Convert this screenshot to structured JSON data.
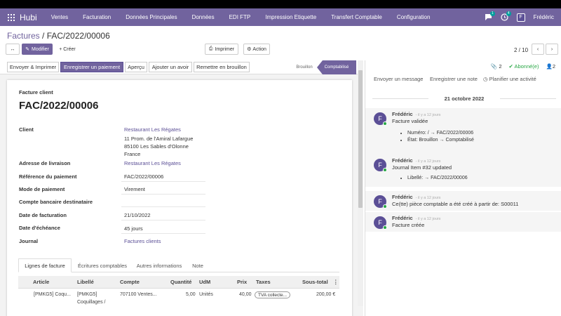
{
  "app": {
    "brand": "Hubi",
    "menu": [
      "Ventes",
      "Facturation",
      "Données Principales",
      "Données",
      "EDI FTP",
      "Impression Etiquette",
      "Transfert Comptable",
      "Configuration"
    ],
    "chat_badge": "1",
    "activity_badge": "4",
    "user_initial": "F",
    "user_name": "Frédéric"
  },
  "breadcrumb": {
    "parent": "Factures",
    "sep": " / ",
    "current": "FAC/2022/00006"
  },
  "toolbar": {
    "edit": "Modifier",
    "create": "+ Créer",
    "print": "Imprimer",
    "action": "Action",
    "pager": "2 / 10"
  },
  "statusbar": {
    "send_print": "Envoyer & Imprimer",
    "register_payment": "Enregistrer un paiement",
    "preview": "Aperçu",
    "credit_note": "Ajouter un avoir",
    "reset_draft": "Remettre en brouillon",
    "stage_draft": "Brouillon",
    "stage_posted": "Comptabilisé"
  },
  "invoice": {
    "type": "Facture client",
    "number": "FAC/2022/00006",
    "fields": {
      "client_label": "Client",
      "client_name": "Restaurant Les Régates",
      "addr1": "11 Prom. de l'Amiral Lafargue",
      "addr2": "85100 Les Sables d'Olonne",
      "addr3": "France",
      "delivery_label": "Adresse de livraison",
      "delivery_value": "Restaurant Les Régates",
      "payref_label": "Référence du paiement",
      "payref_value": "FAC/2022/00006",
      "paymode_label": "Mode de paiement",
      "paymode_value": "Virement",
      "bank_label": "Compte bancaire destinataire",
      "date_label": "Date de facturation",
      "date_value": "21/10/2022",
      "due_label": "Date d'échéance",
      "due_value": "45 jours",
      "journal_label": "Journal",
      "journal_value": "Factures clients"
    },
    "tabs": [
      "Lignes de facture",
      "Écritures comptables",
      "Autres informations",
      "Note"
    ],
    "columns": [
      "Article",
      "Libellé",
      "Compte",
      "Quantité",
      "UdM",
      "Prix",
      "Taxes",
      "Sous-total"
    ],
    "line": {
      "article": "[PMKG5] Coqu...",
      "label1": "[PMKG5]",
      "label2": "Coquillages /",
      "account": "707100 Ventes...",
      "qty": "5,00",
      "uom": "Unités",
      "price": "40,00",
      "tax": "TVA collecte...",
      "subtotal": "200,00 €"
    }
  },
  "chatter": {
    "attachments": "2",
    "follow": "Abonné(e)",
    "followers": "2",
    "send_message": "Envoyer un message",
    "log_note": "Enregistrer une note",
    "schedule": "Planifier une activité",
    "date": "21 octobre 2022",
    "messages": [
      {
        "author": "Frédéric",
        "time": "- il y a 12 jours",
        "body": "Facture validée",
        "items": [
          "Numéro: / → FAC/2022/00006",
          "État: Brouillon → Comptabilisé"
        ]
      },
      {
        "author": "Frédéric",
        "time": "- il y a 12 jours",
        "body": "Journal Item #32 updated",
        "items": [
          "Libellé: → FAC/2022/00006"
        ]
      },
      {
        "author": "Frédéric",
        "time": "- il y a 12 jours",
        "body": "Ce(tte) pièce comptable a été créé à partir de: S00011",
        "items": []
      },
      {
        "author": "Frédéric",
        "time": "- il y a 12 jours",
        "body": "Facture créée",
        "items": []
      }
    ]
  },
  "colors": {
    "brand": "#71639e",
    "accent": "#00a09d"
  }
}
